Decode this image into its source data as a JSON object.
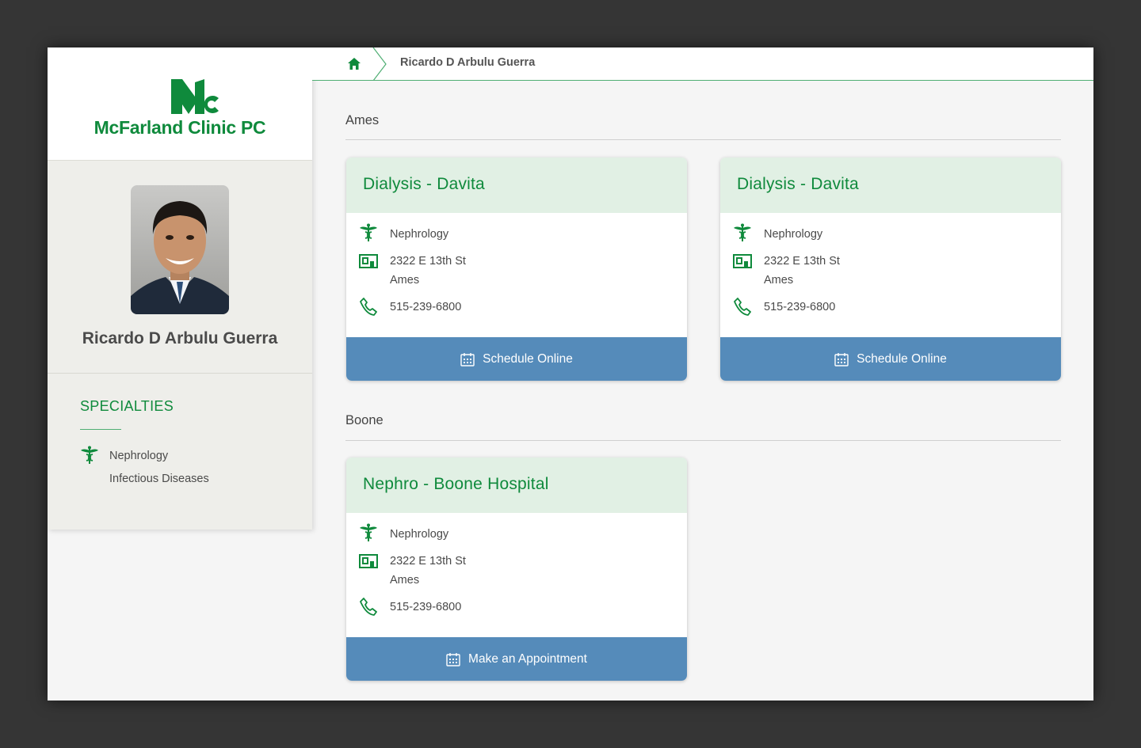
{
  "brand": {
    "logo_initials": "Mc",
    "logo_text": "McFarland Clinic PC",
    "color": "#0f8a3c"
  },
  "breadcrumb": {
    "home_icon": "home-icon",
    "current": "Ricardo D Arbulu Guerra"
  },
  "provider": {
    "name": "Ricardo D Arbulu Guerra",
    "specialties_heading": "SPECIALTIES",
    "specialties": [
      "Nephrology",
      "Infectious Diseases"
    ]
  },
  "sections": [
    {
      "title": "Ames",
      "cards": [
        {
          "title": "Dialysis - Davita",
          "specialty": "Nephrology",
          "address_line1": "2322 E 13th St",
          "address_line2": "Ames",
          "phone": "515-239-6800",
          "button": "Schedule Online"
        },
        {
          "title": "Dialysis - Davita",
          "specialty": "Nephrology",
          "address_line1": "2322 E 13th St",
          "address_line2": "Ames",
          "phone": "515-239-6800",
          "button": "Schedule Online"
        }
      ]
    },
    {
      "title": "Boone",
      "cards": [
        {
          "title": "Nephro - Boone Hospital",
          "specialty": "Nephrology",
          "address_line1": "2322 E 13th St",
          "address_line2": "Ames",
          "phone": "515-239-6800",
          "button": "Make an Appointment"
        }
      ]
    }
  ],
  "colors": {
    "accent": "#0f8a3c",
    "card_header": "#e1f0e4",
    "button": "#558bba",
    "sidebar": "#eeeeea"
  }
}
